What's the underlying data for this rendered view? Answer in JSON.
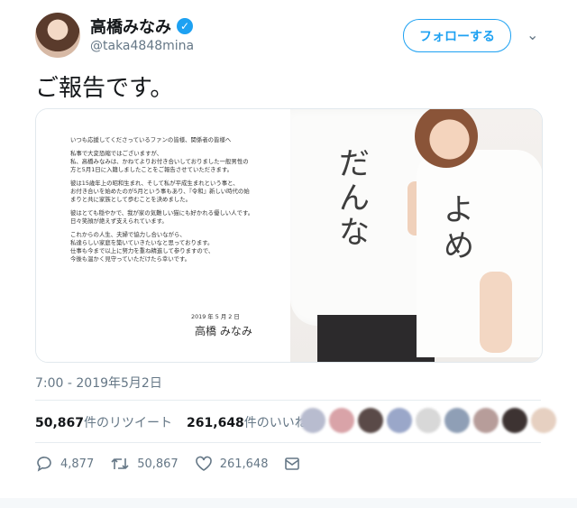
{
  "author": {
    "name": "高橋みなみ",
    "handle": "@taka4848mina",
    "verified_icon": "✓",
    "follow_label": "フォローする",
    "menu_icon": "⌄"
  },
  "tweet": {
    "text": "ご報告です。",
    "timestamp": "7:00 - 2019年5月2日"
  },
  "letter": {
    "lines": [
      "いつも応援してくださっているファンの皆様、関係者の皆様へ",
      "私事で大変恐縮ではございますが、\n私、高橋みなみは、かねてよりお付き合いしておりました一般男性の\n方と5月1日に入籍しましたことをご報告させていただきます。",
      "彼は15歳年上の昭和生まれ、そして私が平成生まれという事と、\nお付き合いを始めたのが5月という事もあり、『令和』新しい時代の始\nまりと共に家族として歩むことを決めました。",
      "彼はとても穏やかで、我が家の気難しい猫にも好かれる優しい人です。\n日々笑顔が絶えず支えられています。",
      "これからの人生、夫婦で協力し合いながら、\n私達らしい家庭を築いていきたいなと思っております。\n仕事も今まで以上に努力を重ね精進して参りますので、\n今後も温かく見守っていただけたら幸いです。"
    ],
    "date": "2019 年 5 月 2 日",
    "signature": "高橋 みなみ"
  },
  "photo": {
    "shirt_left_text": "だんな",
    "shirt_right_text": "よめ"
  },
  "stats": {
    "retweets_count": "50,867",
    "retweets_label": "件のリツイート",
    "likes_count": "261,648",
    "likes_label": "件のいいね"
  },
  "liker_avatars": [
    "#b8bccf",
    "#d9a3a8",
    "#5a4a48",
    "#9aa7c9",
    "#d8d8d8",
    "#8f9fb6",
    "#b79d9a",
    "#3d3332",
    "#e6d0c1"
  ],
  "actions": {
    "replies": "4,877",
    "retweets": "50,867",
    "likes": "261,648"
  }
}
